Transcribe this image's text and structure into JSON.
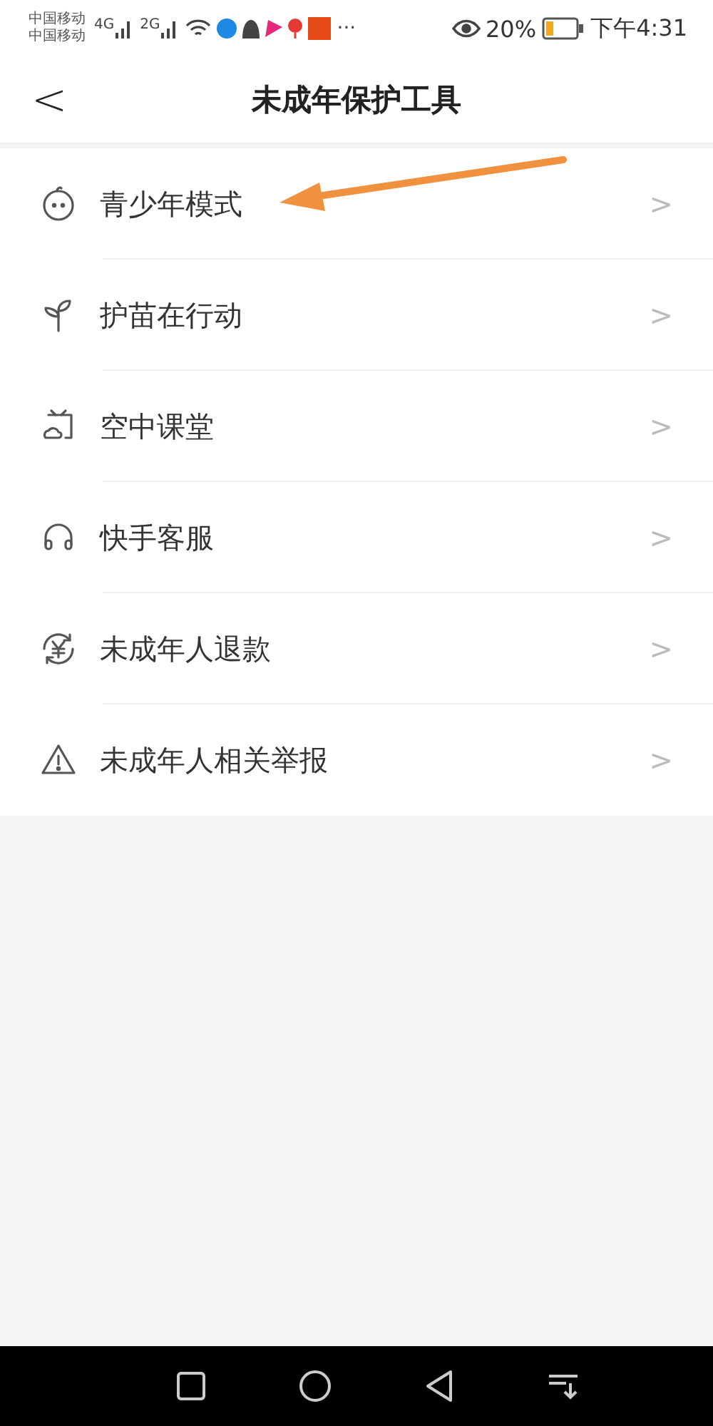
{
  "status_bar": {
    "carriers": [
      "中国移动",
      "中国移动"
    ],
    "networks": [
      "4G",
      "2G"
    ],
    "more": "···",
    "battery_percent": "20%",
    "time": "下午4:31"
  },
  "header": {
    "back": "<",
    "title": "未成年保护工具"
  },
  "menu_items": [
    {
      "kind": "child",
      "label": "青少年模式",
      "chevron": ">",
      "annotated": true
    },
    {
      "kind": "sprout",
      "label": "护苗在行动",
      "chevron": ">"
    },
    {
      "kind": "classroom",
      "label": "空中课堂",
      "chevron": ">"
    },
    {
      "kind": "headset",
      "label": "快手客服",
      "chevron": ">"
    },
    {
      "kind": "refund",
      "label": "未成年人退款",
      "chevron": ">"
    },
    {
      "kind": "warning",
      "label": "未成年人相关举报",
      "chevron": ">"
    }
  ]
}
